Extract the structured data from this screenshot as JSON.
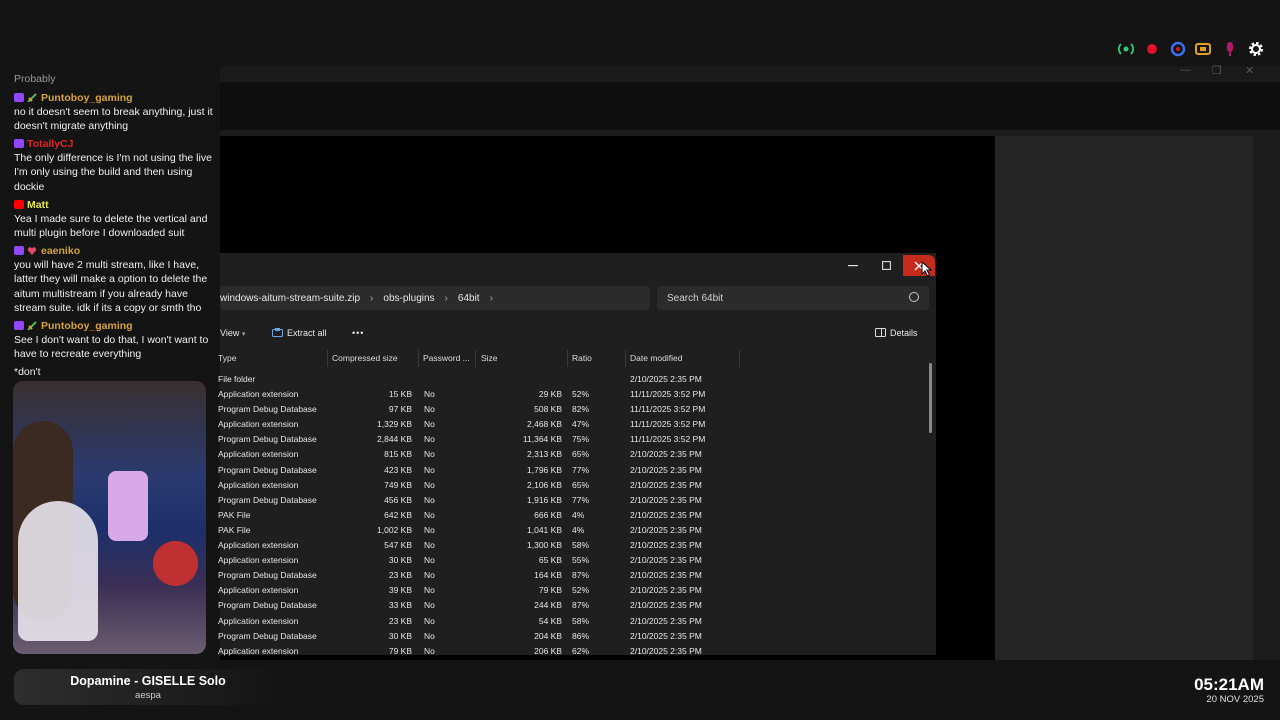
{
  "chat": {
    "top_text": "Probably",
    "messages": [
      {
        "platform": "twitch",
        "user": "Puntoboy_gaming",
        "user_color": "#d4a23a",
        "text": "no it doesn't seem to break anything, just it doesn't migrate anything"
      },
      {
        "platform": "twitch",
        "user": "TotallyCJ",
        "user_color": "#e02424",
        "text": "The only difference is I'm not using the live I'm only using the build and then using dockie"
      },
      {
        "platform": "youtube",
        "user": "Matt",
        "user_color": "#e6e64a",
        "text": "Yea I made sure to delete the vertical and multi plugin before I downloaded suit"
      },
      {
        "platform": "twitch",
        "user": "eaeniko",
        "user_color": "#d4a23a",
        "text": "you will have 2 multi stream, like I have, latter they will make a option to delete the aitum multistream if you already have stream suite. idk if its a copy or smth tho"
      },
      {
        "platform": "twitch",
        "user": "Puntoboy_gaming",
        "user_color": "#d4a23a",
        "text": "See I don't want to do that, I won't want to have to recreate everything"
      }
    ],
    "trailing_text": "*don't"
  },
  "explorer": {
    "path": [
      "windows-aitum-stream-suite.zip",
      "obs-plugins",
      "64bit"
    ],
    "search_placeholder": "Search 64bit",
    "toolbar": {
      "view": "View",
      "extract_all": "Extract all",
      "more": "•••",
      "details": "Details"
    },
    "columns": {
      "type": "Type",
      "compressed": "Compressed size",
      "password": "Password ...",
      "size": "Size",
      "ratio": "Ratio",
      "date": "Date modified"
    },
    "rows": [
      {
        "type": "File folder",
        "comp": "",
        "pwd": "",
        "size": "",
        "ratio": "",
        "date": "2/10/2025 2:35 PM"
      },
      {
        "type": "Application extension",
        "comp": "15 KB",
        "pwd": "No",
        "size": "29 KB",
        "ratio": "52%",
        "date": "11/11/2025 3:52 PM"
      },
      {
        "type": "Program Debug Database",
        "comp": "97 KB",
        "pwd": "No",
        "size": "508 KB",
        "ratio": "82%",
        "date": "11/11/2025 3:52 PM"
      },
      {
        "type": "Application extension",
        "comp": "1,329 KB",
        "pwd": "No",
        "size": "2,468 KB",
        "ratio": "47%",
        "date": "11/11/2025 3:52 PM"
      },
      {
        "type": "Program Debug Database",
        "comp": "2,844 KB",
        "pwd": "No",
        "size": "11,364 KB",
        "ratio": "75%",
        "date": "11/11/2025 3:52 PM"
      },
      {
        "type": "Application extension",
        "comp": "815 KB",
        "pwd": "No",
        "size": "2,313 KB",
        "ratio": "65%",
        "date": "2/10/2025 2:35 PM"
      },
      {
        "type": "Program Debug Database",
        "comp": "423 KB",
        "pwd": "No",
        "size": "1,796 KB",
        "ratio": "77%",
        "date": "2/10/2025 2:35 PM"
      },
      {
        "type": "Application extension",
        "comp": "749 KB",
        "pwd": "No",
        "size": "2,106 KB",
        "ratio": "65%",
        "date": "2/10/2025 2:35 PM"
      },
      {
        "type": "Program Debug Database",
        "comp": "456 KB",
        "pwd": "No",
        "size": "1,916 KB",
        "ratio": "77%",
        "date": "2/10/2025 2:35 PM"
      },
      {
        "type": "PAK File",
        "comp": "642 KB",
        "pwd": "No",
        "size": "666 KB",
        "ratio": "4%",
        "date": "2/10/2025 2:35 PM"
      },
      {
        "type": "PAK File",
        "comp": "1,002 KB",
        "pwd": "No",
        "size": "1,041 KB",
        "ratio": "4%",
        "date": "2/10/2025 2:35 PM"
      },
      {
        "type": "Application extension",
        "comp": "547 KB",
        "pwd": "No",
        "size": "1,300 KB",
        "ratio": "58%",
        "date": "2/10/2025 2:35 PM"
      },
      {
        "type": "Application extension",
        "comp": "30 KB",
        "pwd": "No",
        "size": "65 KB",
        "ratio": "55%",
        "date": "2/10/2025 2:35 PM"
      },
      {
        "type": "Program Debug Database",
        "comp": "23 KB",
        "pwd": "No",
        "size": "164 KB",
        "ratio": "87%",
        "date": "2/10/2025 2:35 PM"
      },
      {
        "type": "Application extension",
        "comp": "39 KB",
        "pwd": "No",
        "size": "79 KB",
        "ratio": "52%",
        "date": "2/10/2025 2:35 PM"
      },
      {
        "type": "Program Debug Database",
        "comp": "33 KB",
        "pwd": "No",
        "size": "244 KB",
        "ratio": "87%",
        "date": "2/10/2025 2:35 PM"
      },
      {
        "type": "Application extension",
        "comp": "23 KB",
        "pwd": "No",
        "size": "54 KB",
        "ratio": "58%",
        "date": "2/10/2025 2:35 PM"
      },
      {
        "type": "Program Debug Database",
        "comp": "30 KB",
        "pwd": "No",
        "size": "204 KB",
        "ratio": "86%",
        "date": "2/10/2025 2:35 PM"
      },
      {
        "type": "Application extension",
        "comp": "79 KB",
        "pwd": "No",
        "size": "206 KB",
        "ratio": "62%",
        "date": "2/10/2025 2:35 PM"
      }
    ]
  },
  "obs": {
    "icons": [
      {
        "name": "stream-status-icon",
        "color": "#2ecc71"
      },
      {
        "name": "record-icon",
        "color": "#e0102a"
      },
      {
        "name": "virtual-cam-icon",
        "color": "#3a6ff0"
      },
      {
        "name": "replay-buffer-icon",
        "color": "#e0a020"
      },
      {
        "name": "mic-icon",
        "color": "#b0186a"
      },
      {
        "name": "settings-gear-icon",
        "color": "#ffffff"
      }
    ]
  },
  "music": {
    "title": "Dopamine - GISELLE Solo",
    "artist": "aespa"
  },
  "clock": {
    "time": "05:21AM",
    "date": "20 NOV 2025"
  }
}
